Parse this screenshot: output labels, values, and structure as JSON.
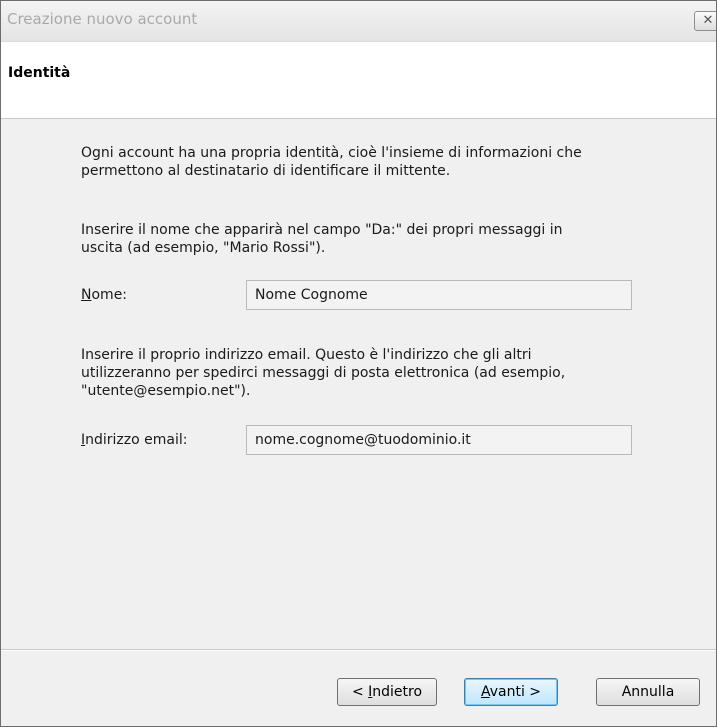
{
  "window": {
    "title": "Creazione nuovo account",
    "close_glyph": "✕"
  },
  "header": {
    "title": "Identità"
  },
  "intro": {
    "lines": [
      "Ogni account ha una propria identità, cioè l'insieme di informazioni che",
      "permettono al destinatario di identificare il mittente."
    ]
  },
  "name_section": {
    "description_lines": [
      "Inserire il nome che apparirà nel campo \"Da:\" dei propri messaggi in",
      "uscita (ad esempio, \"Mario Rossi\")."
    ],
    "label_access": "N",
    "label_rest": "ome:",
    "value": "Nome Cognome"
  },
  "email_section": {
    "description_lines": [
      "Inserire il proprio indirizzo email. Questo è l'indirizzo che gli altri",
      "utilizzeranno per spedirci messaggi di posta elettronica (ad esempio,",
      "\"utente@esempio.net\")."
    ],
    "label_access": "I",
    "label_rest": "ndirizzo email:",
    "value": "nome.cognome@tuodominio.it"
  },
  "buttons": {
    "back_prefix": "< ",
    "back_access": "I",
    "back_rest": "ndietro",
    "next_access": "A",
    "next_rest": "vanti >",
    "cancel": "Annulla"
  }
}
